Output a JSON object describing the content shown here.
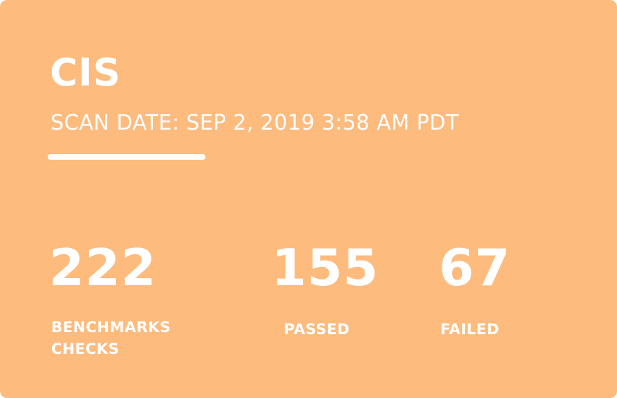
{
  "card": {
    "title": "CIS",
    "scan_date": "SCAN DATE: SEP 2, 2019 3:58 AM PDT",
    "background_color": "#fdbb7e",
    "text_color": "#ffffff"
  },
  "stats": {
    "benchmarks": {
      "value": "222",
      "label_line1": "BENCHMARKS",
      "label_line2": "CHECKS"
    },
    "passed": {
      "value": "155",
      "label": "PASSED"
    },
    "failed": {
      "value": "67",
      "label": "FAILED"
    }
  }
}
